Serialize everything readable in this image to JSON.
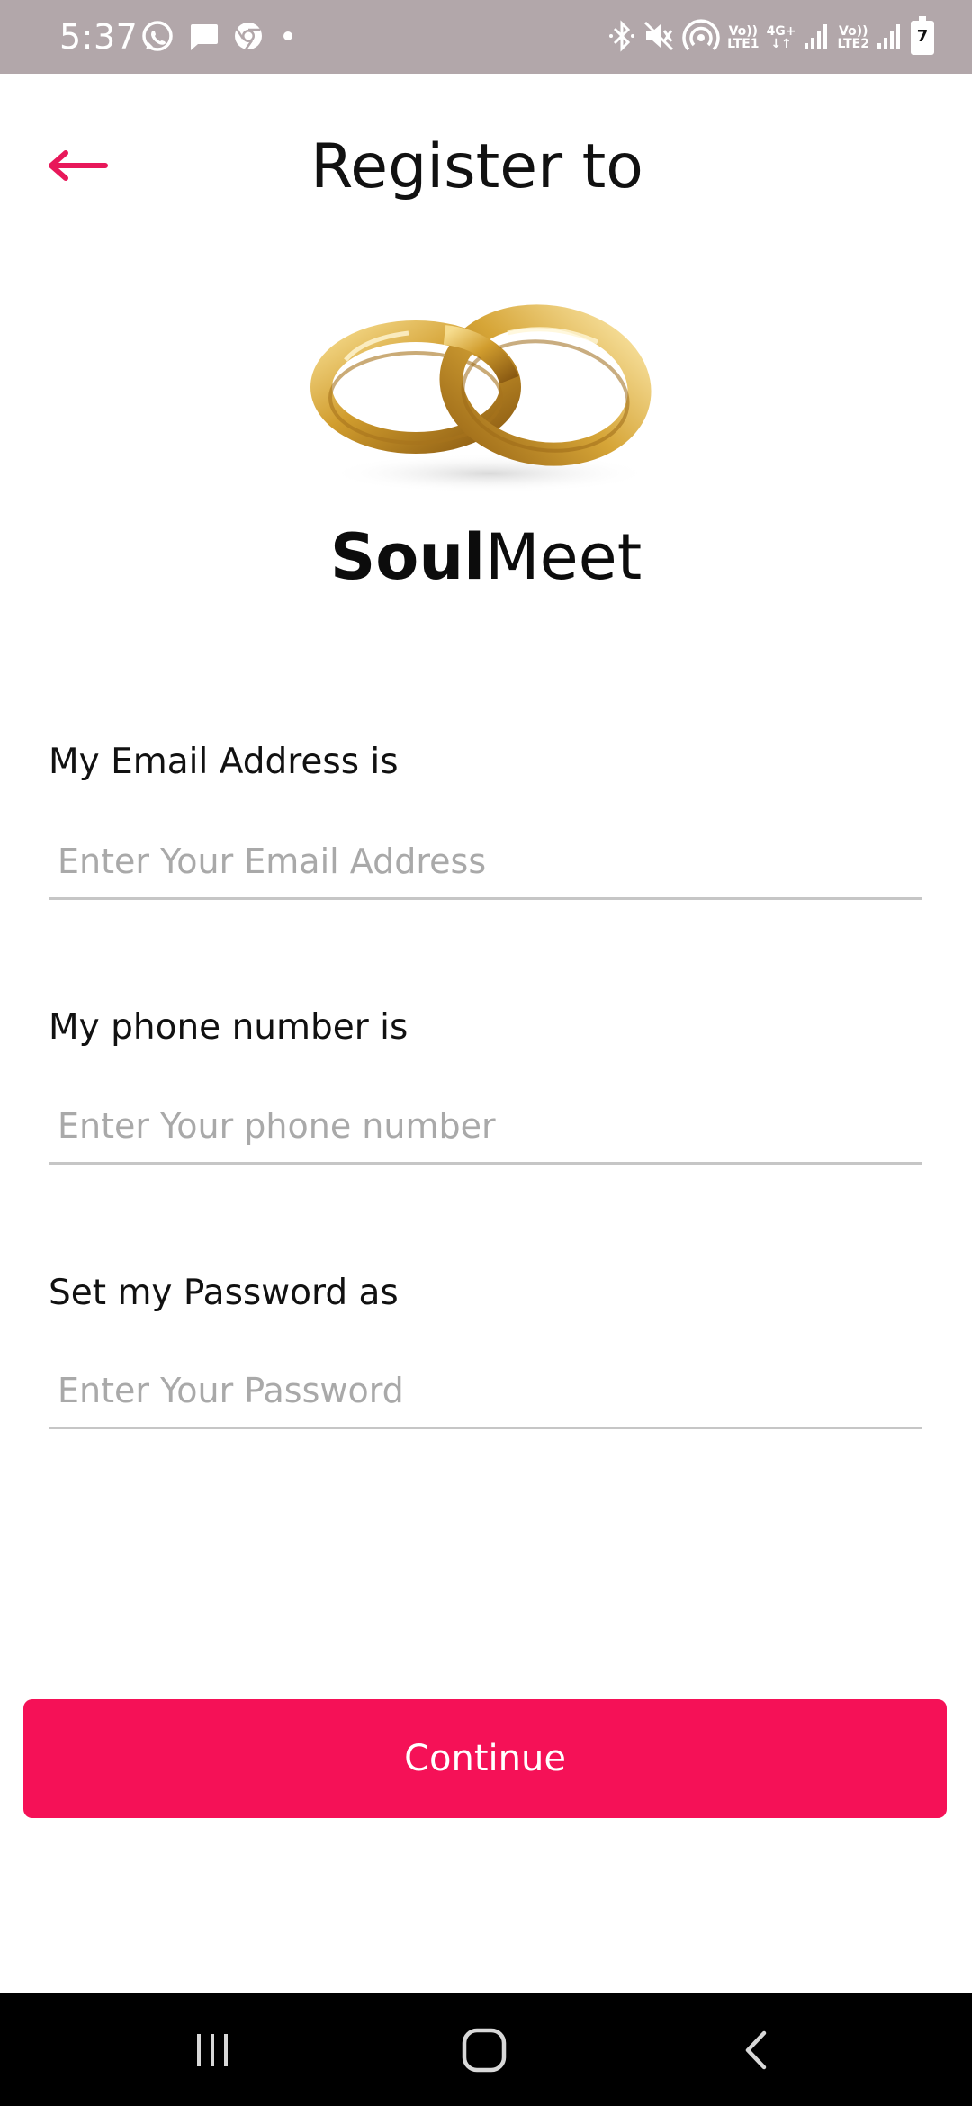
{
  "status_bar": {
    "time": "5:37",
    "left_icons": [
      "whatsapp-icon",
      "message-icon",
      "chrome-icon",
      "dot-icon"
    ],
    "right_icons": [
      "bluetooth-icon",
      "mute-icon",
      "hotspot-icon",
      "lte1-icon",
      "4g-icon",
      "signal-icon",
      "lte2-icon",
      "signal-icon",
      "battery-icon"
    ],
    "sim1_top": "Vo))",
    "sim1_bottom": "LTE1",
    "data_top": "4G+",
    "data_bottom": "↓↑",
    "sim2_top": "Vo))",
    "sim2_bottom": "LTE2",
    "battery": "7"
  },
  "header": {
    "title": "Register to",
    "back_icon": "arrow-left-icon"
  },
  "brand": {
    "logo_icon": "wedding-rings-icon",
    "name_bold": "Soul",
    "name_regular": "Meet"
  },
  "form": {
    "email": {
      "label": "My Email Address is",
      "placeholder": "Enter Your Email Address",
      "value": ""
    },
    "phone": {
      "label": "My phone number is",
      "placeholder": "Enter Your phone number",
      "value": ""
    },
    "password": {
      "label": "Set my Password as",
      "placeholder": "Enter Your Password",
      "value": ""
    }
  },
  "continue_label": "Continue",
  "nav_bar": {
    "icons": [
      "recent-apps-icon",
      "home-icon",
      "back-icon"
    ]
  },
  "colors": {
    "accent": "#f51157",
    "status_bar": "#b2a7aa",
    "placeholder": "#a9a9a9",
    "underline": "#c6c6c6",
    "gold": "#d4a537"
  }
}
